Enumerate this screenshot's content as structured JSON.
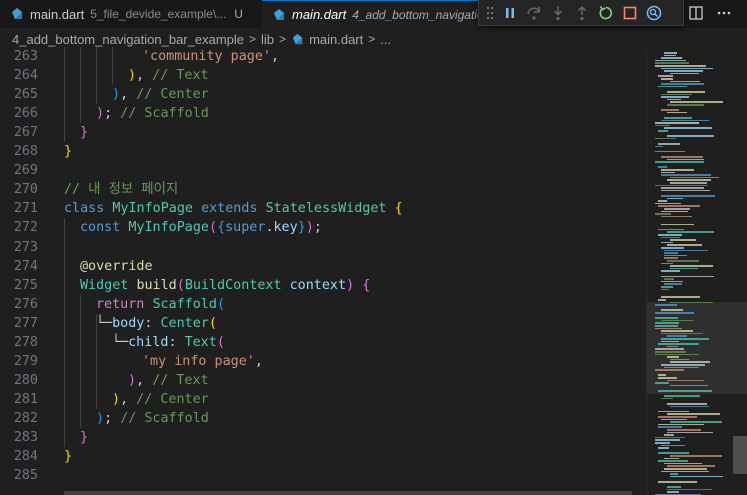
{
  "tabs": [
    {
      "name": "main.dart",
      "description": "5_file_devide_example\\...",
      "status": "U",
      "active": false
    },
    {
      "name": "main.dart",
      "description": "4_add_bottom_navigatio",
      "status": "",
      "active": true
    }
  ],
  "debug_toolbar": {
    "buttons": [
      "pause-icon",
      "step-over-icon",
      "step-into-icon",
      "step-out-icon",
      "restart-icon",
      "stop-icon",
      "devtools-icon"
    ]
  },
  "editor_actions": [
    "split-editor-icon",
    "more-actions-icon"
  ],
  "breadcrumb": {
    "folder": "4_add_bottom_navigation_bar_example",
    "subfolder": "lib",
    "file": "main.dart",
    "more": "..."
  },
  "lines": [
    {
      "n": "263",
      "tokens": [
        {
          "c": "s",
          "t": "'community page'"
        },
        {
          "c": "pl",
          "t": ","
        }
      ]
    },
    {
      "n": "264",
      "tokens": [
        {
          "c": "b1",
          "t": ")"
        },
        {
          "c": "pl",
          "t": ", "
        },
        {
          "c": "c",
          "t": "// Text"
        }
      ]
    },
    {
      "n": "265",
      "tokens": [
        {
          "c": "b3",
          "t": ")"
        },
        {
          "c": "pl",
          "t": ", "
        },
        {
          "c": "c",
          "t": "// Center"
        }
      ]
    },
    {
      "n": "266",
      "tokens": [
        {
          "c": "b2",
          "t": ")"
        },
        {
          "c": "pl",
          "t": "; "
        },
        {
          "c": "c",
          "t": "// Scaffold"
        }
      ]
    },
    {
      "n": "267",
      "tokens": [
        {
          "c": "b2",
          "t": "}"
        }
      ]
    },
    {
      "n": "268",
      "tokens": [
        {
          "c": "b1",
          "t": "}"
        }
      ]
    },
    {
      "n": "269",
      "tokens": []
    },
    {
      "n": "270",
      "tokens": [
        {
          "c": "c",
          "t": "// 내 정보 페이지"
        }
      ]
    },
    {
      "n": "271",
      "tokens": [
        {
          "c": "k",
          "t": "class"
        },
        {
          "c": "pl",
          "t": " "
        },
        {
          "c": "t",
          "t": "MyInfoPage"
        },
        {
          "c": "pl",
          "t": " "
        },
        {
          "c": "k",
          "t": "extends"
        },
        {
          "c": "pl",
          "t": " "
        },
        {
          "c": "t",
          "t": "StatelessWidget"
        },
        {
          "c": "pl",
          "t": " "
        },
        {
          "c": "b1",
          "t": "{"
        }
      ]
    },
    {
      "n": "272",
      "tokens": [
        {
          "c": "k",
          "t": "const"
        },
        {
          "c": "pl",
          "t": " "
        },
        {
          "c": "t",
          "t": "MyInfoPage"
        },
        {
          "c": "b2",
          "t": "("
        },
        {
          "c": "b3",
          "t": "{"
        },
        {
          "c": "k",
          "t": "super"
        },
        {
          "c": "pl",
          "t": "."
        },
        {
          "c": "p",
          "t": "key"
        },
        {
          "c": "b3",
          "t": "}"
        },
        {
          "c": "b2",
          "t": ")"
        },
        {
          "c": "pl",
          "t": ";"
        }
      ]
    },
    {
      "n": "273",
      "tokens": []
    },
    {
      "n": "274",
      "tokens": [
        {
          "c": "f",
          "t": "@override"
        }
      ]
    },
    {
      "n": "275",
      "tokens": [
        {
          "c": "t",
          "t": "Widget"
        },
        {
          "c": "pl",
          "t": " "
        },
        {
          "c": "f",
          "t": "build"
        },
        {
          "c": "b2",
          "t": "("
        },
        {
          "c": "t",
          "t": "BuildContext"
        },
        {
          "c": "pl",
          "t": " "
        },
        {
          "c": "p",
          "t": "context"
        },
        {
          "c": "b2",
          "t": ")"
        },
        {
          "c": "pl",
          "t": " "
        },
        {
          "c": "b2",
          "t": "{"
        }
      ]
    },
    {
      "n": "276",
      "tokens": [
        {
          "c": "kc",
          "t": "return"
        },
        {
          "c": "pl",
          "t": " "
        },
        {
          "c": "t",
          "t": "Scaffold"
        },
        {
          "c": "b3",
          "t": "("
        }
      ]
    },
    {
      "n": "277",
      "tokens": [
        {
          "c": "pl",
          "t": "└─"
        },
        {
          "c": "p",
          "t": "body"
        },
        {
          "c": "pl",
          "t": ": "
        },
        {
          "c": "t",
          "t": "Center"
        },
        {
          "c": "b1",
          "t": "("
        }
      ]
    },
    {
      "n": "278",
      "tokens": [
        {
          "c": "pl",
          "t": "└─"
        },
        {
          "c": "p",
          "t": "child"
        },
        {
          "c": "pl",
          "t": ": "
        },
        {
          "c": "t",
          "t": "Text"
        },
        {
          "c": "b2",
          "t": "("
        }
      ]
    },
    {
      "n": "279",
      "tokens": [
        {
          "c": "s",
          "t": "'my info page'"
        },
        {
          "c": "pl",
          "t": ","
        }
      ]
    },
    {
      "n": "280",
      "tokens": [
        {
          "c": "b2",
          "t": ")"
        },
        {
          "c": "pl",
          "t": ", "
        },
        {
          "c": "c",
          "t": "// Text"
        }
      ]
    },
    {
      "n": "281",
      "tokens": [
        {
          "c": "b1",
          "t": ")"
        },
        {
          "c": "pl",
          "t": ", "
        },
        {
          "c": "c",
          "t": "// Center"
        }
      ]
    },
    {
      "n": "282",
      "tokens": [
        {
          "c": "b3",
          "t": ")"
        },
        {
          "c": "pl",
          "t": "; "
        },
        {
          "c": "c",
          "t": "// Scaffold"
        }
      ]
    },
    {
      "n": "283",
      "tokens": [
        {
          "c": "b2",
          "t": "}"
        }
      ]
    },
    {
      "n": "284",
      "tokens": [
        {
          "c": "b1",
          "t": "}"
        }
      ]
    },
    {
      "n": "285",
      "tokens": []
    }
  ],
  "colors": {
    "accent": "#0078d4",
    "untracked": "#73c991",
    "keyword": "#569cd6",
    "type": "#4ec9b0",
    "string": "#ce9178",
    "comment": "#6a9955"
  }
}
